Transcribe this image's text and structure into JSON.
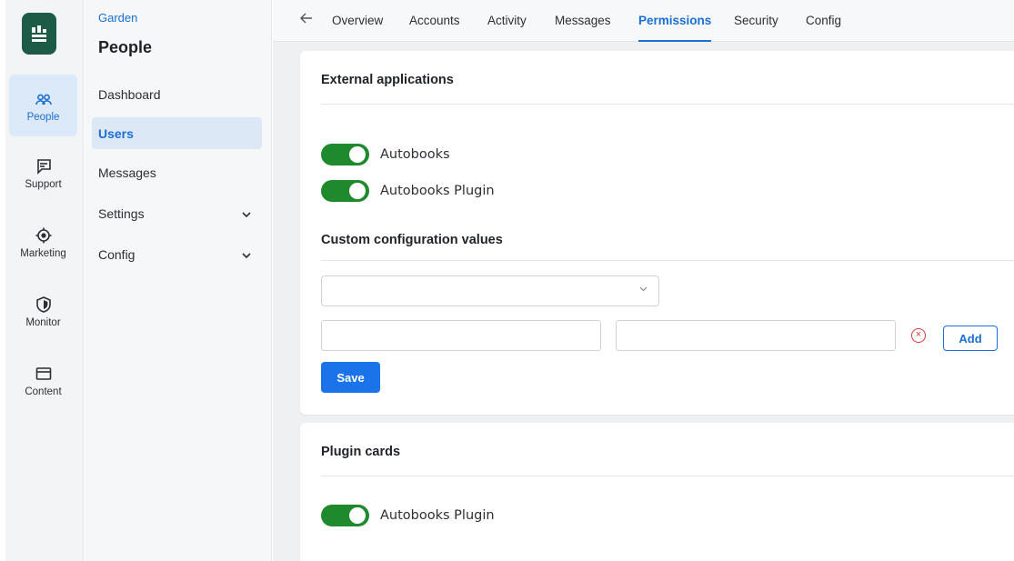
{
  "rail": {
    "logo_icon": "garden-logo-icon",
    "items": [
      {
        "label": "People",
        "icon": "people-icon",
        "active": true
      },
      {
        "label": "Support",
        "icon": "chat-icon"
      },
      {
        "label": "Marketing",
        "icon": "target-icon"
      },
      {
        "label": "Monitor",
        "icon": "shield-icon"
      },
      {
        "label": "Content",
        "icon": "window-icon"
      }
    ]
  },
  "subnav": {
    "breadcrumb": "Garden",
    "title": "People",
    "items": [
      {
        "label": "Dashboard"
      },
      {
        "label": "Users",
        "active": true
      },
      {
        "label": "Messages"
      },
      {
        "label": "Settings",
        "expandable": true
      },
      {
        "label": "Config",
        "expandable": true
      }
    ]
  },
  "tabs": {
    "back_icon": "arrow-left-icon",
    "items": [
      "Overview",
      "Accounts",
      "Activity",
      "Messages",
      "Permissions",
      "Security",
      "Config"
    ],
    "active": "Permissions"
  },
  "external_apps": {
    "title": "External applications",
    "toggles": [
      {
        "label": "Autobooks",
        "on": true
      },
      {
        "label": "Autobooks Plugin",
        "on": true
      }
    ]
  },
  "custom_config": {
    "title": "Custom configuration values",
    "select_value": "",
    "key_value": "",
    "value_value": "",
    "add_label": "Add",
    "save_label": "Save"
  },
  "plugin_cards": {
    "title": "Plugin cards",
    "toggles": [
      {
        "label": "Autobooks Plugin",
        "on": true
      }
    ]
  },
  "colors": {
    "accent": "#1a6fd4",
    "toggle_on": "#1f8a2d",
    "logo": "#1e5b47",
    "danger": "#d93a3a"
  }
}
